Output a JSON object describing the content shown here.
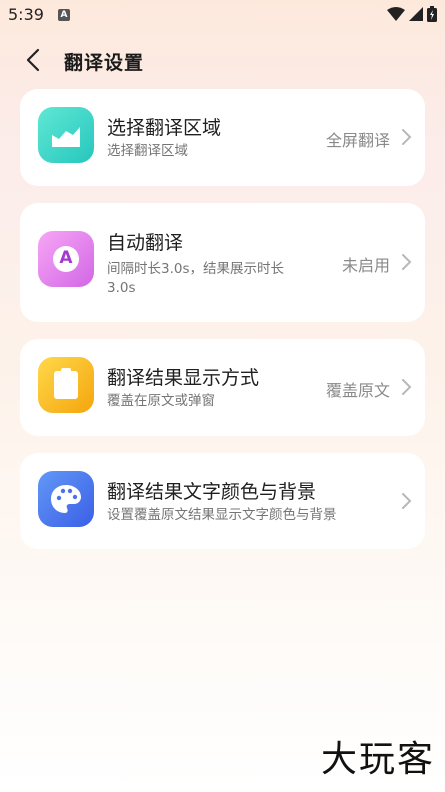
{
  "status_bar": {
    "time": "5:39",
    "app_icon_letter": "A",
    "icons": [
      "app-notification-icon",
      "wifi-icon",
      "signal-icon",
      "battery-charging-icon"
    ]
  },
  "header": {
    "title": "翻译设置",
    "back_icon": "back-arrow-icon"
  },
  "cards": [
    {
      "title": "选择翻译区域",
      "subtitle": "选择翻译区域",
      "value": "全屏翻译",
      "icon": "area-chart-icon",
      "colors": [
        "#4fe3cf",
        "#28c9c0"
      ]
    },
    {
      "title": "自动翻译",
      "subtitle": "间隔时长3.0s，结果展示时长3.0s",
      "subtitle_line1": "间隔时长3.0s，结果展示时长",
      "subtitle_line2": "3.0s",
      "value": "未启用",
      "icon": "letter-a-icon",
      "icon_letter": "A",
      "colors": [
        "#f49cf3",
        "#d46ae8"
      ]
    },
    {
      "title": "翻译结果显示方式",
      "subtitle": "覆盖在原文或弹窗",
      "value": "覆盖原文",
      "icon": "clipboard-icon",
      "colors": [
        "#ffd43b",
        "#f6a90f"
      ]
    },
    {
      "title": "翻译结果文字颜色与背景",
      "subtitle": "设置覆盖原文结果显示文字颜色与背景",
      "value": "",
      "icon": "palette-icon",
      "colors": [
        "#5b8ff5",
        "#3f63e8"
      ]
    }
  ],
  "watermark": "大玩客"
}
